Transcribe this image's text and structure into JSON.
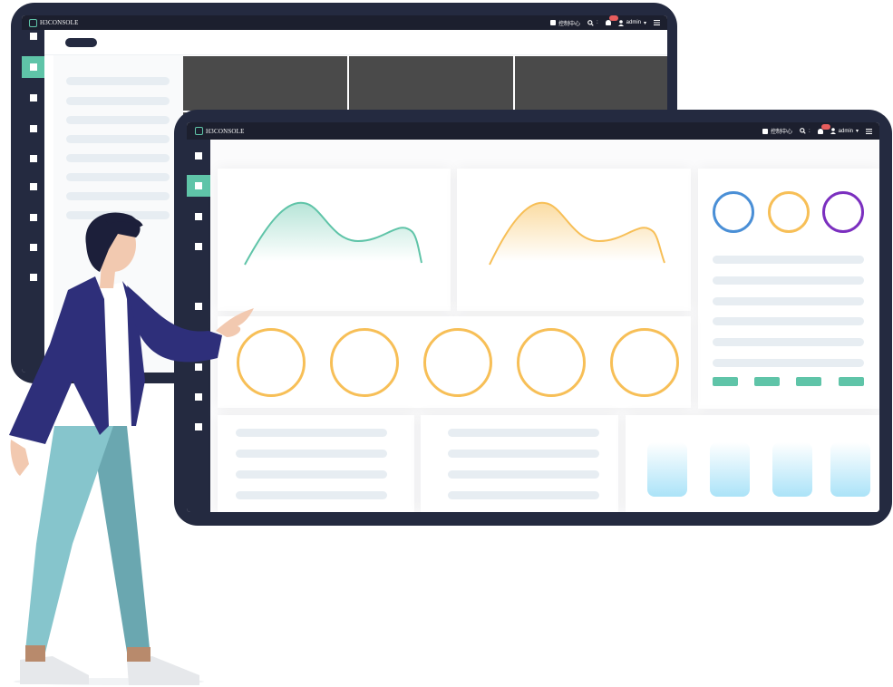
{
  "app": {
    "brand": "H3CONSOLE"
  },
  "topbar": {
    "control_center_label": "控制中心",
    "notification_count": "",
    "user_label": "admin",
    "user_caret": "▾",
    "search_colon": ":"
  },
  "colors": {
    "device_frame": "#242a40",
    "accent_green": "#5fc4a8",
    "accent_orange": "#f7bf57",
    "ring_blue": "#4a8fd6",
    "ring_purple": "#7b2fbf",
    "placeholder_bar": "#e7edf2",
    "badge_red": "#e85d5d"
  },
  "icons": {
    "logo": "h3c-logo-icon",
    "control_center": "square-icon",
    "search": "search-icon",
    "notifications": "bell-icon",
    "user": "user-icon",
    "menu": "hamburger-menu-icon"
  },
  "back_device": {
    "sidebar_item_count": 9,
    "active_index": 1
  },
  "front_device": {
    "sidebar_item_count": 9,
    "active_index": 1
  },
  "illustration": {
    "subject": "person-pointing-at-dashboard"
  }
}
